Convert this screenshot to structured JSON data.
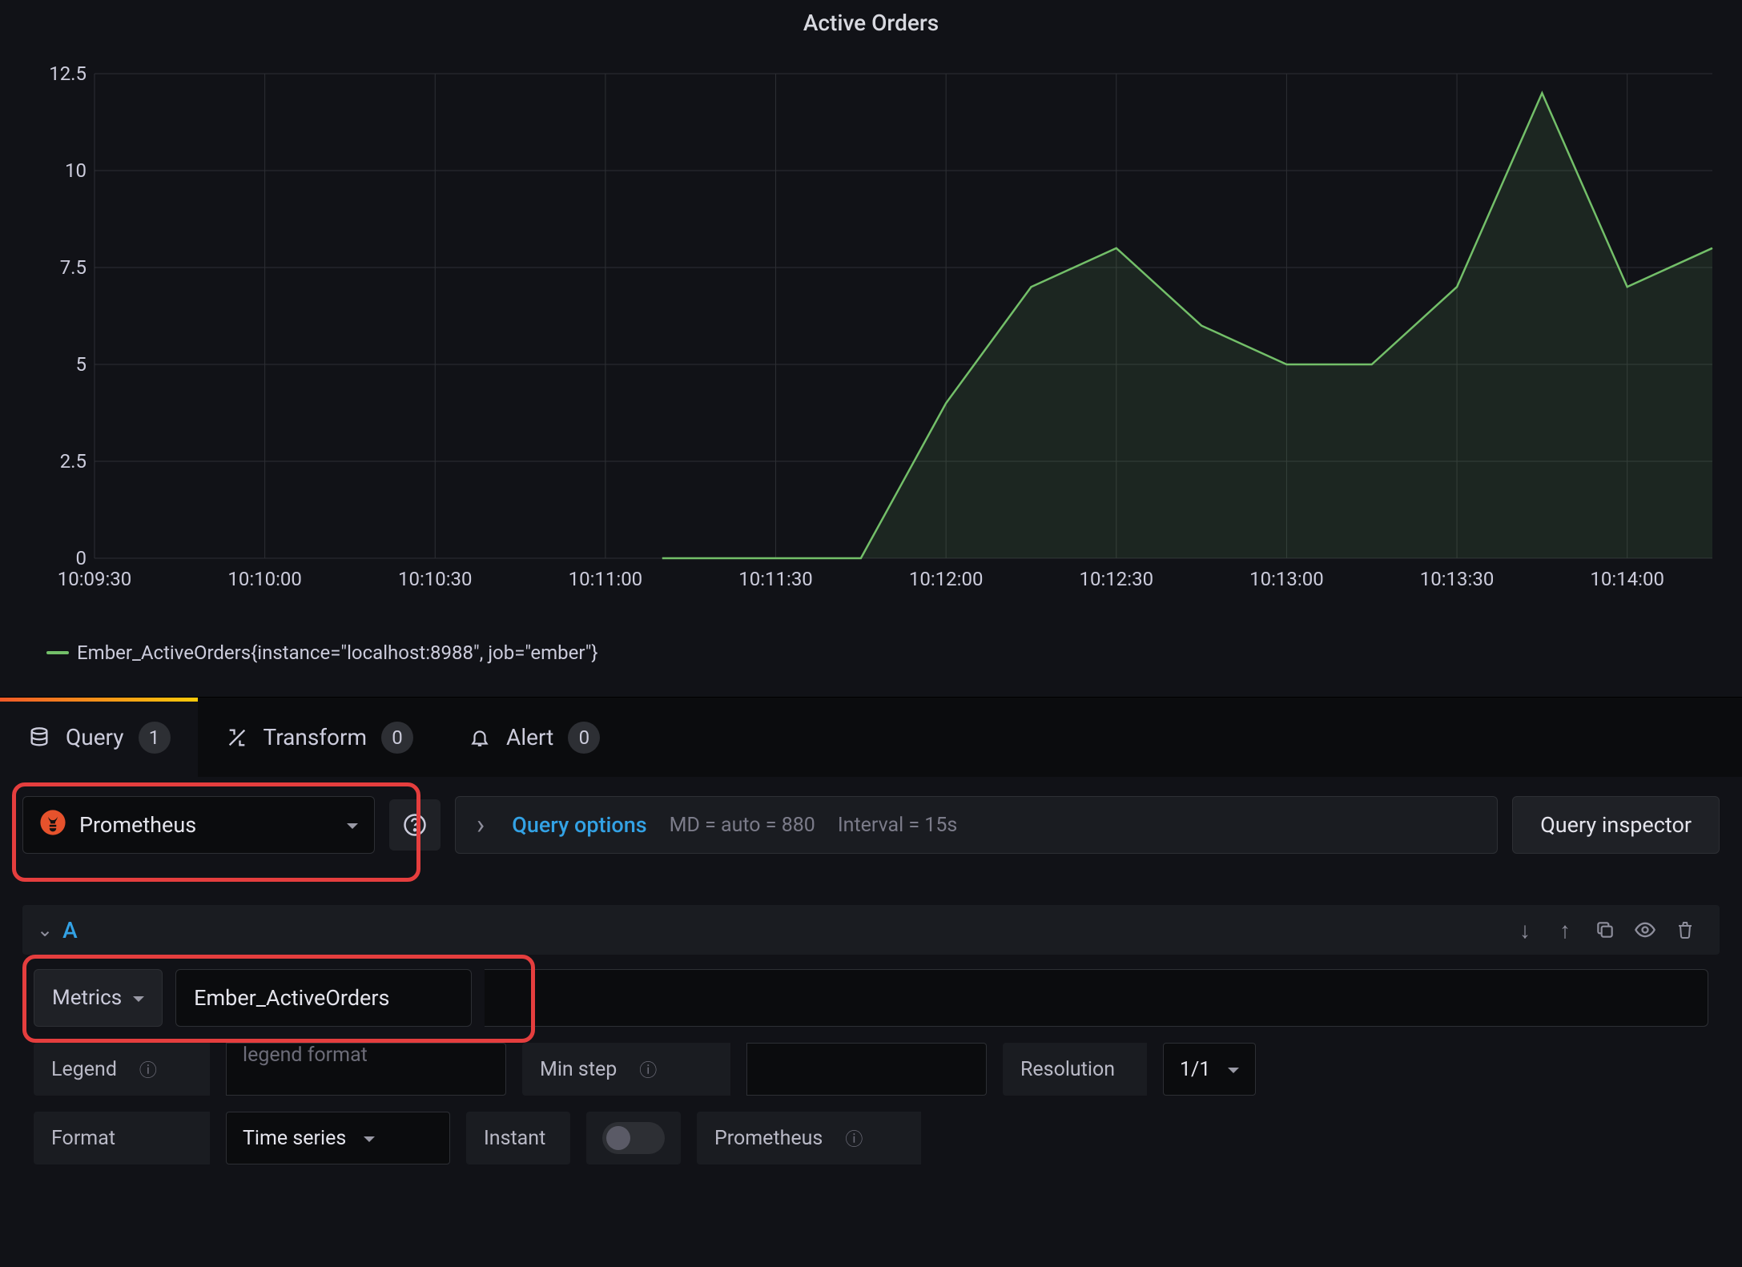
{
  "chart_data": {
    "type": "area",
    "title": "Active Orders",
    "xlabel": "",
    "ylabel": "",
    "ylim": [
      0,
      12.5
    ],
    "y_ticks": [
      0,
      2.5,
      5.0,
      7.5,
      10.0,
      12.5
    ],
    "x_ticks": [
      "10:09:30",
      "10:10:00",
      "10:10:30",
      "10:11:00",
      "10:11:30",
      "10:12:00",
      "10:12:30",
      "10:13:00",
      "10:13:30",
      "10:14:00"
    ],
    "series": [
      {
        "name": "Ember_ActiveOrders{instance=\"localhost:8988\", job=\"ember\"}",
        "color": "#73bf69",
        "x": [
          "10:11:10",
          "10:11:30",
          "10:11:45",
          "10:12:00",
          "10:12:15",
          "10:12:30",
          "10:12:45",
          "10:13:00",
          "10:13:15",
          "10:13:30",
          "10:13:45",
          "10:14:00",
          "10:14:15"
        ],
        "values": [
          0,
          0,
          0,
          4,
          7,
          8,
          6,
          5,
          5,
          7,
          12,
          7,
          8
        ]
      }
    ]
  },
  "legend": {
    "label": "Ember_ActiveOrders{instance=\"localhost:8988\", job=\"ember\"}"
  },
  "tabs": {
    "query": {
      "label": "Query",
      "count": "1"
    },
    "transform": {
      "label": "Transform",
      "count": "0"
    },
    "alert": {
      "label": "Alert",
      "count": "0"
    }
  },
  "datasource": {
    "name": "Prometheus"
  },
  "options_bar": {
    "link": "Query options",
    "md_text": "MD = auto = 880",
    "interval_text": "Interval = 15s",
    "inspector_btn": "Query inspector"
  },
  "query_row": {
    "letter": "A",
    "metrics_btn": "Metrics",
    "metric_value": "Ember_ActiveOrders",
    "fields": {
      "legend_label": "Legend",
      "legend_placeholder": "legend format",
      "minstep_label": "Min step",
      "resolution_label": "Resolution",
      "resolution_value": "1/1",
      "format_label": "Format",
      "format_value": "Time series",
      "instant_label": "Instant",
      "prom_label": "Prometheus"
    }
  }
}
